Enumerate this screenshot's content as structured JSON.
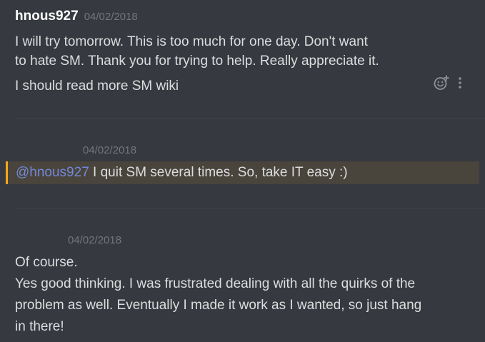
{
  "messages": {
    "first": {
      "username": "hnous927",
      "timestamp": "04/02/2018",
      "lines": [
        "I will try tomorrow. This is too much for one day. Don't want",
        "to hate SM. Thank you for trying to help. Really appreciate it.",
        "I should read more SM wiki"
      ]
    },
    "second": {
      "timestamp": "04/02/2018",
      "mention": "@hnous927",
      "text": " I quit SM several times. So, take IT easy :)"
    },
    "third": {
      "timestamp": "04/02/2018",
      "lines": [
        "Of course.",
        "Yes good thinking. I was frustrated dealing with all the quirks of the",
        "problem as well. Eventually I made it work as I wanted, so just hang",
        "in there!"
      ]
    }
  },
  "colors": {
    "background": "#36393f",
    "mention_highlight": "#49443c",
    "mention_accent": "#faa61a",
    "mention_user": "#7289da"
  },
  "icons": {
    "reaction": "add-reaction-icon",
    "more": "more-options-icon"
  }
}
